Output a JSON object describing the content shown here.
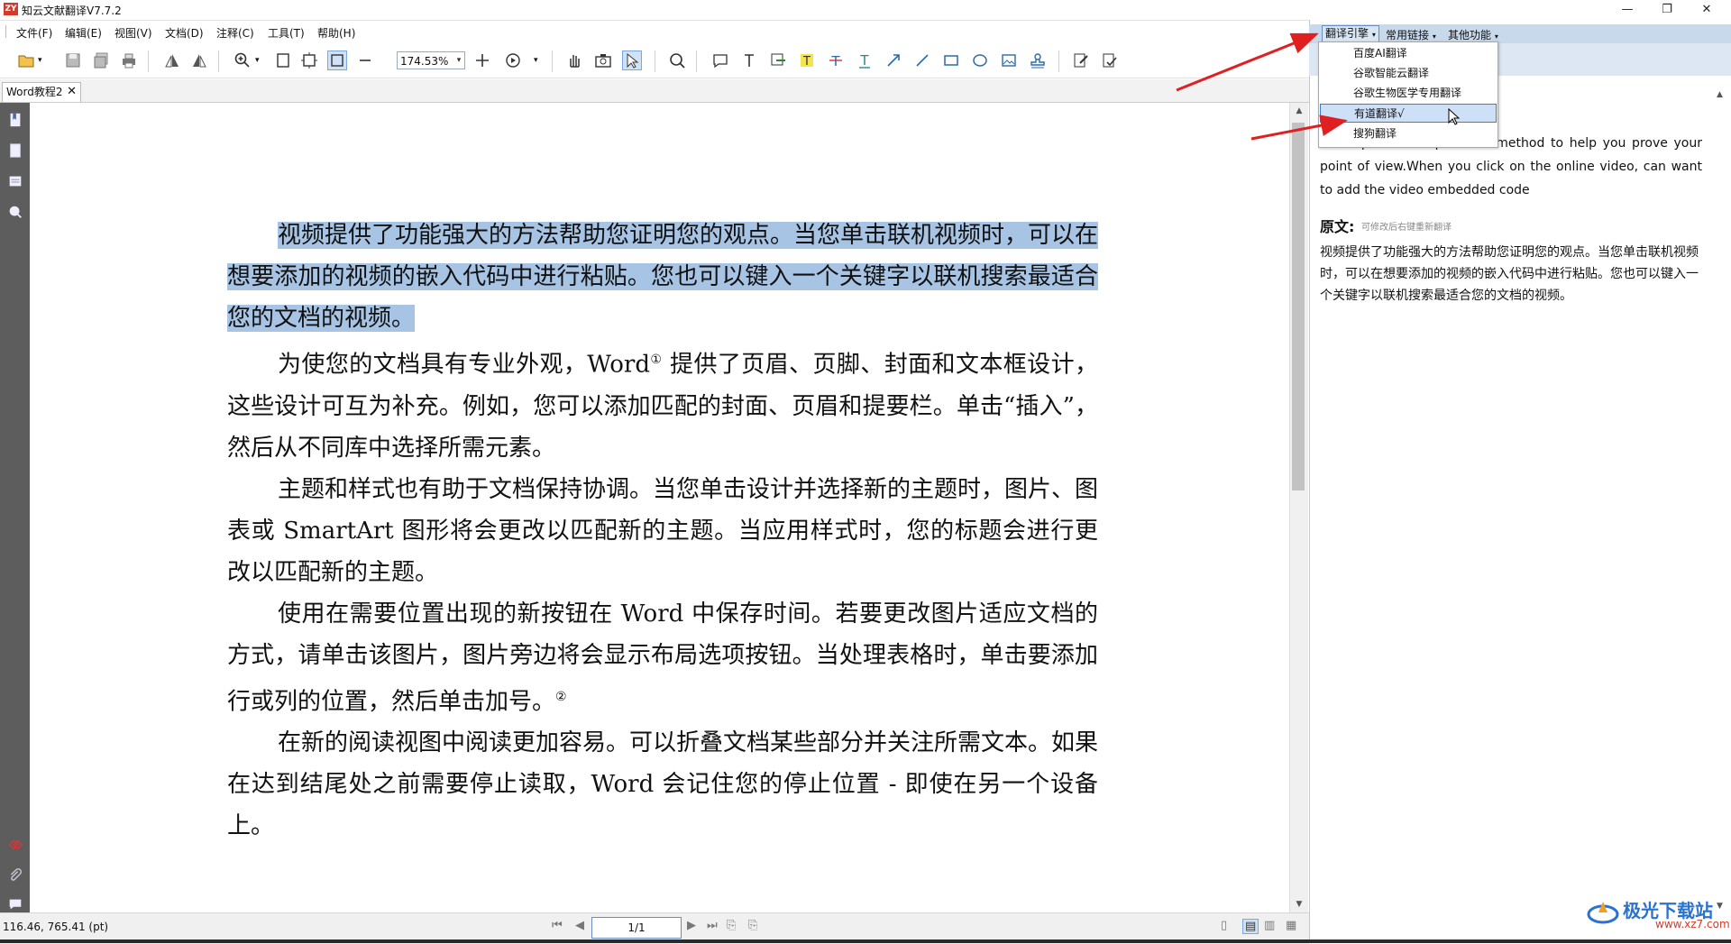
{
  "app": {
    "logo_text": "ZY",
    "title": "知云文献翻译V7.7.2",
    "window_controls": [
      "—",
      "❐",
      "✕"
    ]
  },
  "menu": {
    "items": [
      "文件(F)",
      "编辑(E)",
      "视图(V)",
      "文档(D)",
      "注释(C)",
      "工具(T)",
      "帮助(H)"
    ]
  },
  "toolbar": {
    "zoom_value": "174.53%",
    "icons": [
      "open-icon",
      "save-icon",
      "save-all-icon",
      "print-icon",
      "rotate-left-icon",
      "rotate-right-icon",
      "zoom-in-icon",
      "fit-page-icon",
      "fit-width-icon",
      "fit-visible-icon",
      "zoom-out-icon",
      "add-icon",
      "audio-icon",
      "hand-icon",
      "snapshot-icon",
      "select-icon",
      "search-icon",
      "comment-icon",
      "text-select-icon",
      "note-icon",
      "highlight-icon",
      "strikethrough-icon",
      "underline-icon",
      "arrow-icon",
      "line-icon",
      "rectangle-icon",
      "ellipse-icon",
      "image-icon",
      "stamp-icon",
      "edit-icon",
      "sign-icon"
    ]
  },
  "tabs": {
    "doc_tab": "Word教程2",
    "close": "✕"
  },
  "document": {
    "para1": "视频提供了功能强大的方法帮助您证明您的观点。当您单击联机视频时，可以在想要添加的视频的嵌入代码中进行粘贴。您也可以键入一个关键字以联机搜索最适合您的文档的视频。",
    "para2a": "为使您的文档具有专业外观，Word",
    "para2_sup": "①",
    "para2b": " 提供了页眉、页脚、封面和文本框设计，这些设计可互为补充。例如，您可以添加匹配的封面、页眉和提要栏。单击“插入”，然后从不同库中选择所需元素。",
    "para3": "主题和样式也有助于文档保持协调。当您单击设计并选择新的主题时，图片、图表或 SmartArt 图形将会更改以匹配新的主题。当应用样式时，您的标题会进行更改以匹配新的主题。",
    "para4a": "使用在需要位置出现的新按钮在 Word 中保存时间。若要更改图片适应文档的方式，请单击该图片，图片旁边将会显示布局选项按钮。当处理表格时，单击要添加行或列的位置，然后单击加号。",
    "para4_sup": "②",
    "para5": "在新的阅读视图中阅读更加容易。可以折叠文档某些部分并关注所需文本。如果在达到结尾处之前需要停止读取，Word 会记住您的停止位置 - 即使在另一个设备上。"
  },
  "status": {
    "coords": "116.46, 765.41 (pt)",
    "page": "1/1"
  },
  "right_panel": {
    "tabs": [
      "翻译引擎",
      "常用链接",
      "其他功能"
    ],
    "translation": "Video provides a powerful method to help you prove your point of view.When you click on the online video, can want to add the video embedded code",
    "original_label": "原文:",
    "original_hint": "可修改后右键重新翻译",
    "original_text": "视频提供了功能强大的方法帮助您证明您的观点。当您单击联机视频时，可以在想要添加的视频的嵌入代码中进行粘贴。您也可以键入一个关键字以联机搜索最适合您的文档的视频。"
  },
  "dropdown": {
    "items": [
      "百度AI翻译",
      "谷歌智能云翻译",
      "谷歌生物医学专用翻译",
      "有道翻译√",
      "搜狗翻译"
    ],
    "selected_index": 3
  },
  "watermark": {
    "text": "极光下载站",
    "url": "www.xz7.com"
  },
  "colors": {
    "highlight": "#a8c4e4",
    "annotation_arrow": "#e02020",
    "panel_bar": "#c9d9ec",
    "sidebar": "#5d5d5d"
  }
}
